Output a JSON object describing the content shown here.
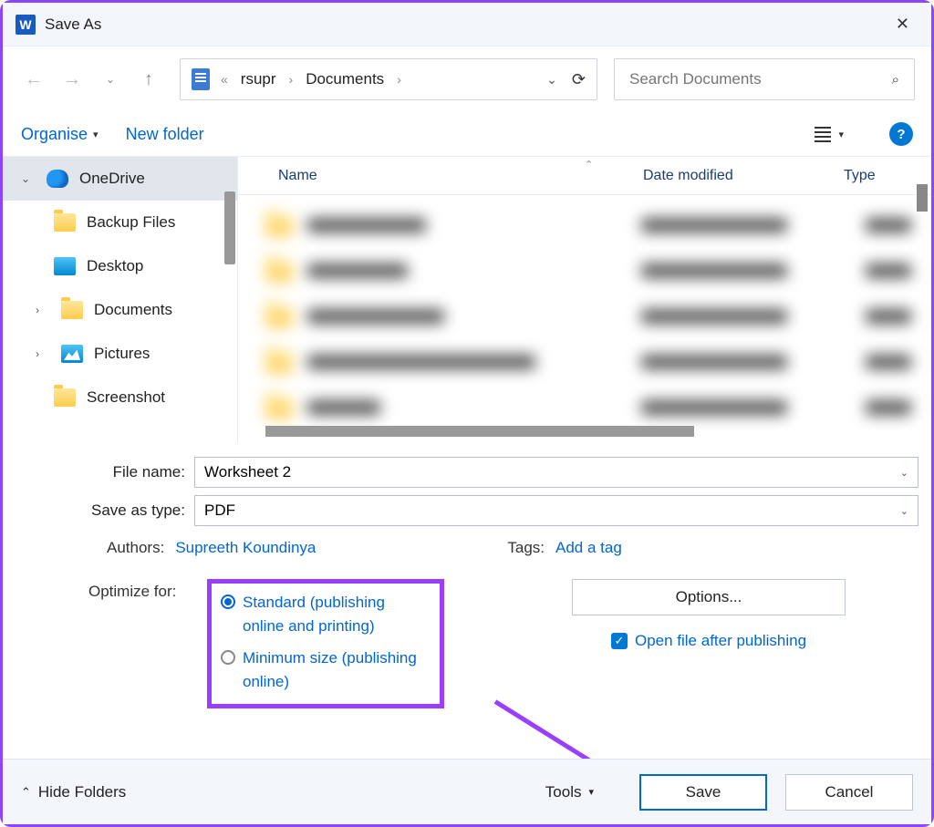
{
  "title": "Save As",
  "breadcrumb": {
    "seg1": "rsupr",
    "seg2": "Documents"
  },
  "search_placeholder": "Search Documents",
  "toolbar": {
    "organise": "Organise",
    "new_folder": "New folder"
  },
  "sidebar": {
    "onedrive": "OneDrive",
    "backup": "Backup Files",
    "desktop": "Desktop",
    "documents": "Documents",
    "pictures": "Pictures",
    "screenshot": "Screenshot"
  },
  "columns": {
    "name": "Name",
    "date": "Date modified",
    "type": "Type"
  },
  "form": {
    "filename_label": "File name:",
    "filename_value": "Worksheet 2",
    "saveastype_label": "Save as type:",
    "saveastype_value": "PDF",
    "authors_label": "Authors:",
    "authors_value": "Supreeth Koundinya",
    "tags_label": "Tags:",
    "tags_value": "Add a tag",
    "optimize_label": "Optimize for:",
    "opt_standard": "Standard (publishing online and printing)",
    "opt_minimum": "Minimum size (publishing online)",
    "options_btn": "Options...",
    "open_after": "Open file after publishing"
  },
  "footer": {
    "hide_folders": "Hide Folders",
    "tools": "Tools",
    "save": "Save",
    "cancel": "Cancel"
  }
}
